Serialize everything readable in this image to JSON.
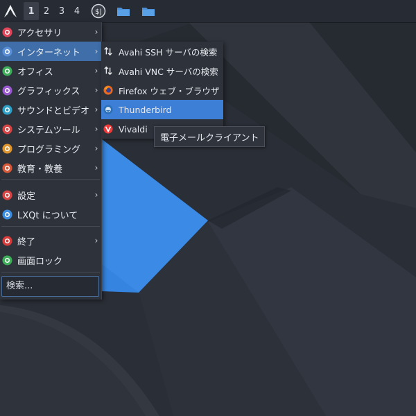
{
  "panel": {
    "launcher_icon": "arch-logo-icon",
    "desktops": [
      "1",
      "2",
      "3",
      "4"
    ],
    "active_desktop": "1",
    "tray": [
      {
        "name": "money-badge-icon"
      },
      {
        "name": "folder-icon"
      },
      {
        "name": "folder-icon"
      }
    ]
  },
  "main_menu": {
    "items": [
      {
        "label": "アクセサリ",
        "icon": "accessories-icon",
        "color": "#e0455a",
        "submenu": true
      },
      {
        "label": "インターネット",
        "icon": "internet-globe-icon",
        "color": "#5b8fd6",
        "submenu": true,
        "highlighted": true
      },
      {
        "label": "オフィス",
        "icon": "office-check-icon",
        "color": "#3fae5a",
        "submenu": true
      },
      {
        "label": "グラフィックス",
        "icon": "graphics-palette-icon",
        "color": "#9b59d0",
        "submenu": true
      },
      {
        "label": "サウンドとビデオ",
        "icon": "sound-video-icon",
        "color": "#2fa0c8",
        "submenu": true
      },
      {
        "label": "システムツール",
        "icon": "system-tools-icon",
        "color": "#d64545",
        "submenu": true
      },
      {
        "label": "プログラミング",
        "icon": "programming-icon",
        "color": "#e0962f",
        "submenu": true
      },
      {
        "label": "教育・教養",
        "icon": "education-icon",
        "color": "#d65a3a",
        "submenu": true
      }
    ],
    "items2": [
      {
        "label": "設定",
        "icon": "settings-icon",
        "color": "#d64545",
        "submenu": true
      },
      {
        "label": "LXQt について",
        "icon": "lxqt-logo-icon",
        "color": "#3d8ee0",
        "submenu": false
      }
    ],
    "items3": [
      {
        "label": "終了",
        "icon": "power-icon",
        "color": "#d63c3c",
        "submenu": true
      },
      {
        "label": "画面ロック",
        "icon": "lock-icon",
        "color": "#3fae5a",
        "submenu": false
      }
    ],
    "search_placeholder": "検索..."
  },
  "internet_submenu": {
    "items": [
      {
        "label": "Avahi SSH サーバの検索",
        "icon": "network-arrows-icon"
      },
      {
        "label": "Avahi VNC サーバの検索",
        "icon": "network-arrows-icon"
      },
      {
        "label": "Firefox ウェブ・ブラウザ",
        "icon": "firefox-icon"
      },
      {
        "label": "Thunderbird",
        "icon": "thunderbird-icon",
        "highlighted": true
      },
      {
        "label": "Vivaldi",
        "icon": "vivaldi-icon"
      }
    ]
  },
  "tooltip": {
    "text": "電子メールクライアント"
  }
}
